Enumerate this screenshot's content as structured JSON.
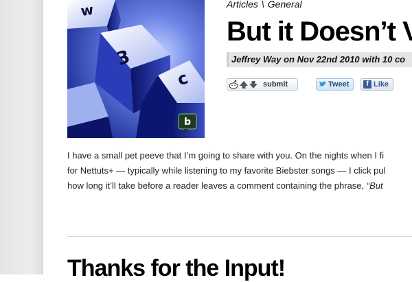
{
  "breadcrumb": {
    "category": "Articles",
    "separator": "\\",
    "subcategory": "General"
  },
  "post": {
    "title": "But it Doesn’t V",
    "meta": "Jeffrey Way on Nov 22nd 2010 with 10 co"
  },
  "thumbnail": {
    "keys": [
      "w",
      "3",
      "c"
    ],
    "badge": "b"
  },
  "share": {
    "reddit_label": "submit",
    "tweet_label": "Tweet",
    "like_label": "Like",
    "fb_letter": "f"
  },
  "body": {
    "line1": "I have a small pet peeve that I’m going to share with you. On the nights when I fi",
    "line2": "for Nettuts+ — typically while listening to my favorite Biebster songs — I click pul",
    "line3_plain": "how long it’ll take before a reader leaves a comment containing the phrase, ",
    "line3_quote": "“But"
  },
  "section": {
    "heading": "Thanks for the Input!"
  },
  "colors": {
    "thumb_blue": "#1a2ea8",
    "badge_green": "#1f3b1f",
    "fb_blue": "#3b5998",
    "tweet_blue": "#244e7a"
  }
}
